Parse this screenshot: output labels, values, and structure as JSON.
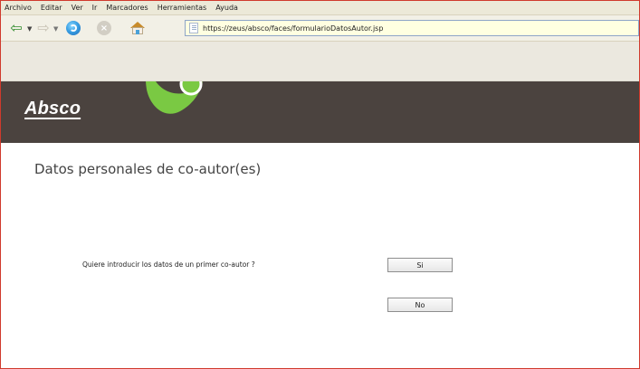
{
  "browser": {
    "menu": [
      "Archivo",
      "Editar",
      "Ver",
      "Ir",
      "Marcadores",
      "Herramientas",
      "Ayuda"
    ],
    "address": "https://zeus/absco/faces/formularioDatosAutor.jsp",
    "icons": {
      "back": "back-arrow-icon",
      "back_dropdown": "back-dropdown-icon",
      "forward": "forward-arrow-icon",
      "forward_dropdown": "forward-dropdown-icon",
      "reload": "reload-icon",
      "stop": "stop-icon",
      "home": "home-icon",
      "page": "page-icon"
    }
  },
  "site": {
    "logo": "Absco",
    "colors": {
      "banner": "#4b433f",
      "logo_mark": "#7ac943",
      "page_title": "#444444",
      "frame_border": "#d03a2d"
    }
  },
  "page": {
    "title": "Datos personales de co-autor(es)",
    "question": "Quiere introducir los datos de un primer co-autor ?",
    "buttons": {
      "yes": "Si",
      "no": "No"
    }
  }
}
